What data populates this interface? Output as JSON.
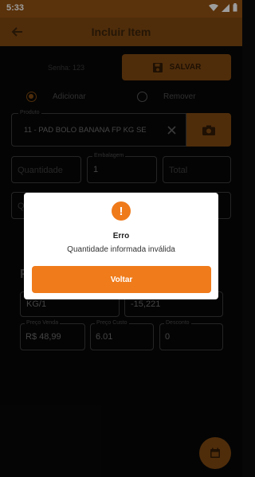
{
  "status_bar": {
    "time": "5:33"
  },
  "app_bar": {
    "title": "Incluir Item"
  },
  "senha": "Senha: 123",
  "save_button": {
    "label": "SALVAR"
  },
  "operation": {
    "add_label": "Adicionar",
    "remove_label": "Remover",
    "selected": "Adicionar"
  },
  "produto": {
    "label": "Produto",
    "value": "11 - PAD BOLO BANANA FP KG SE"
  },
  "quantidade": {
    "placeholder": "Quantidade"
  },
  "embalagem": {
    "label": "Embalagem",
    "value": "1"
  },
  "total": {
    "placeholder": "Total"
  },
  "partial_row": {
    "placeholder": "Qt"
  },
  "section_heading": "F",
  "unidade": {
    "value": "KG/1"
  },
  "estoque": {
    "value": "-15,221"
  },
  "preco_venda": {
    "label": "Preço Venda",
    "value": "R$ 48,99"
  },
  "preco_custo": {
    "label": "Preço Custo",
    "value": "6.01"
  },
  "desconto": {
    "label": "Desconto",
    "value": "0"
  },
  "dialog": {
    "title": "Erro",
    "message": "Quantidade informada inválida",
    "button_label": "Voltar"
  },
  "colors": {
    "accent": "#f07b1a",
    "dark_accent": "#7a4511",
    "background": "#070707"
  }
}
